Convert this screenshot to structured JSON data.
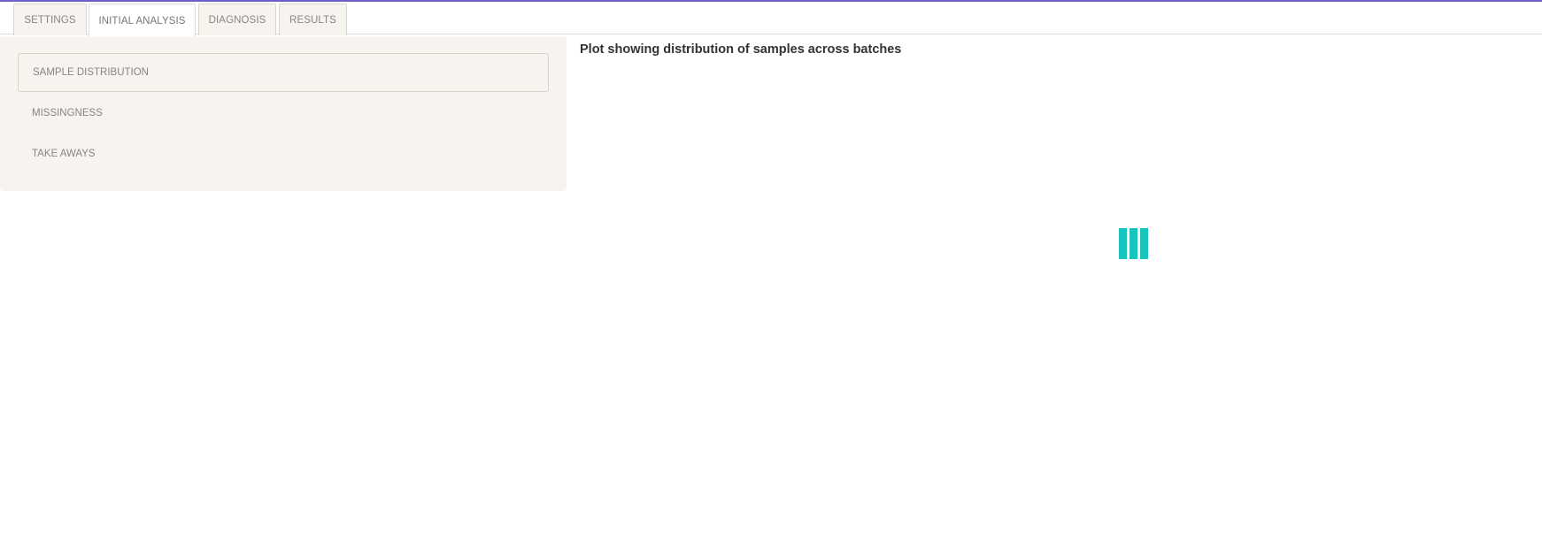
{
  "tabs": [
    {
      "label": "SETTINGS",
      "active": false
    },
    {
      "label": "INITIAL ANALYSIS",
      "active": true
    },
    {
      "label": "DIAGNOSIS",
      "active": false
    },
    {
      "label": "RESULTS",
      "active": false
    }
  ],
  "sidebar": {
    "items": [
      {
        "label": "SAMPLE DISTRIBUTION",
        "active": true
      },
      {
        "label": "MISSINGNESS",
        "active": false
      },
      {
        "label": "TAKE AWAYS",
        "active": false
      }
    ]
  },
  "main": {
    "title": "Plot showing distribution of samples across batches",
    "loader_icon": "loading-bars-icon"
  },
  "colors": {
    "accent": "#6f5fc9",
    "loader": "#17c3bf",
    "panel_bg": "#f7f4f0"
  }
}
